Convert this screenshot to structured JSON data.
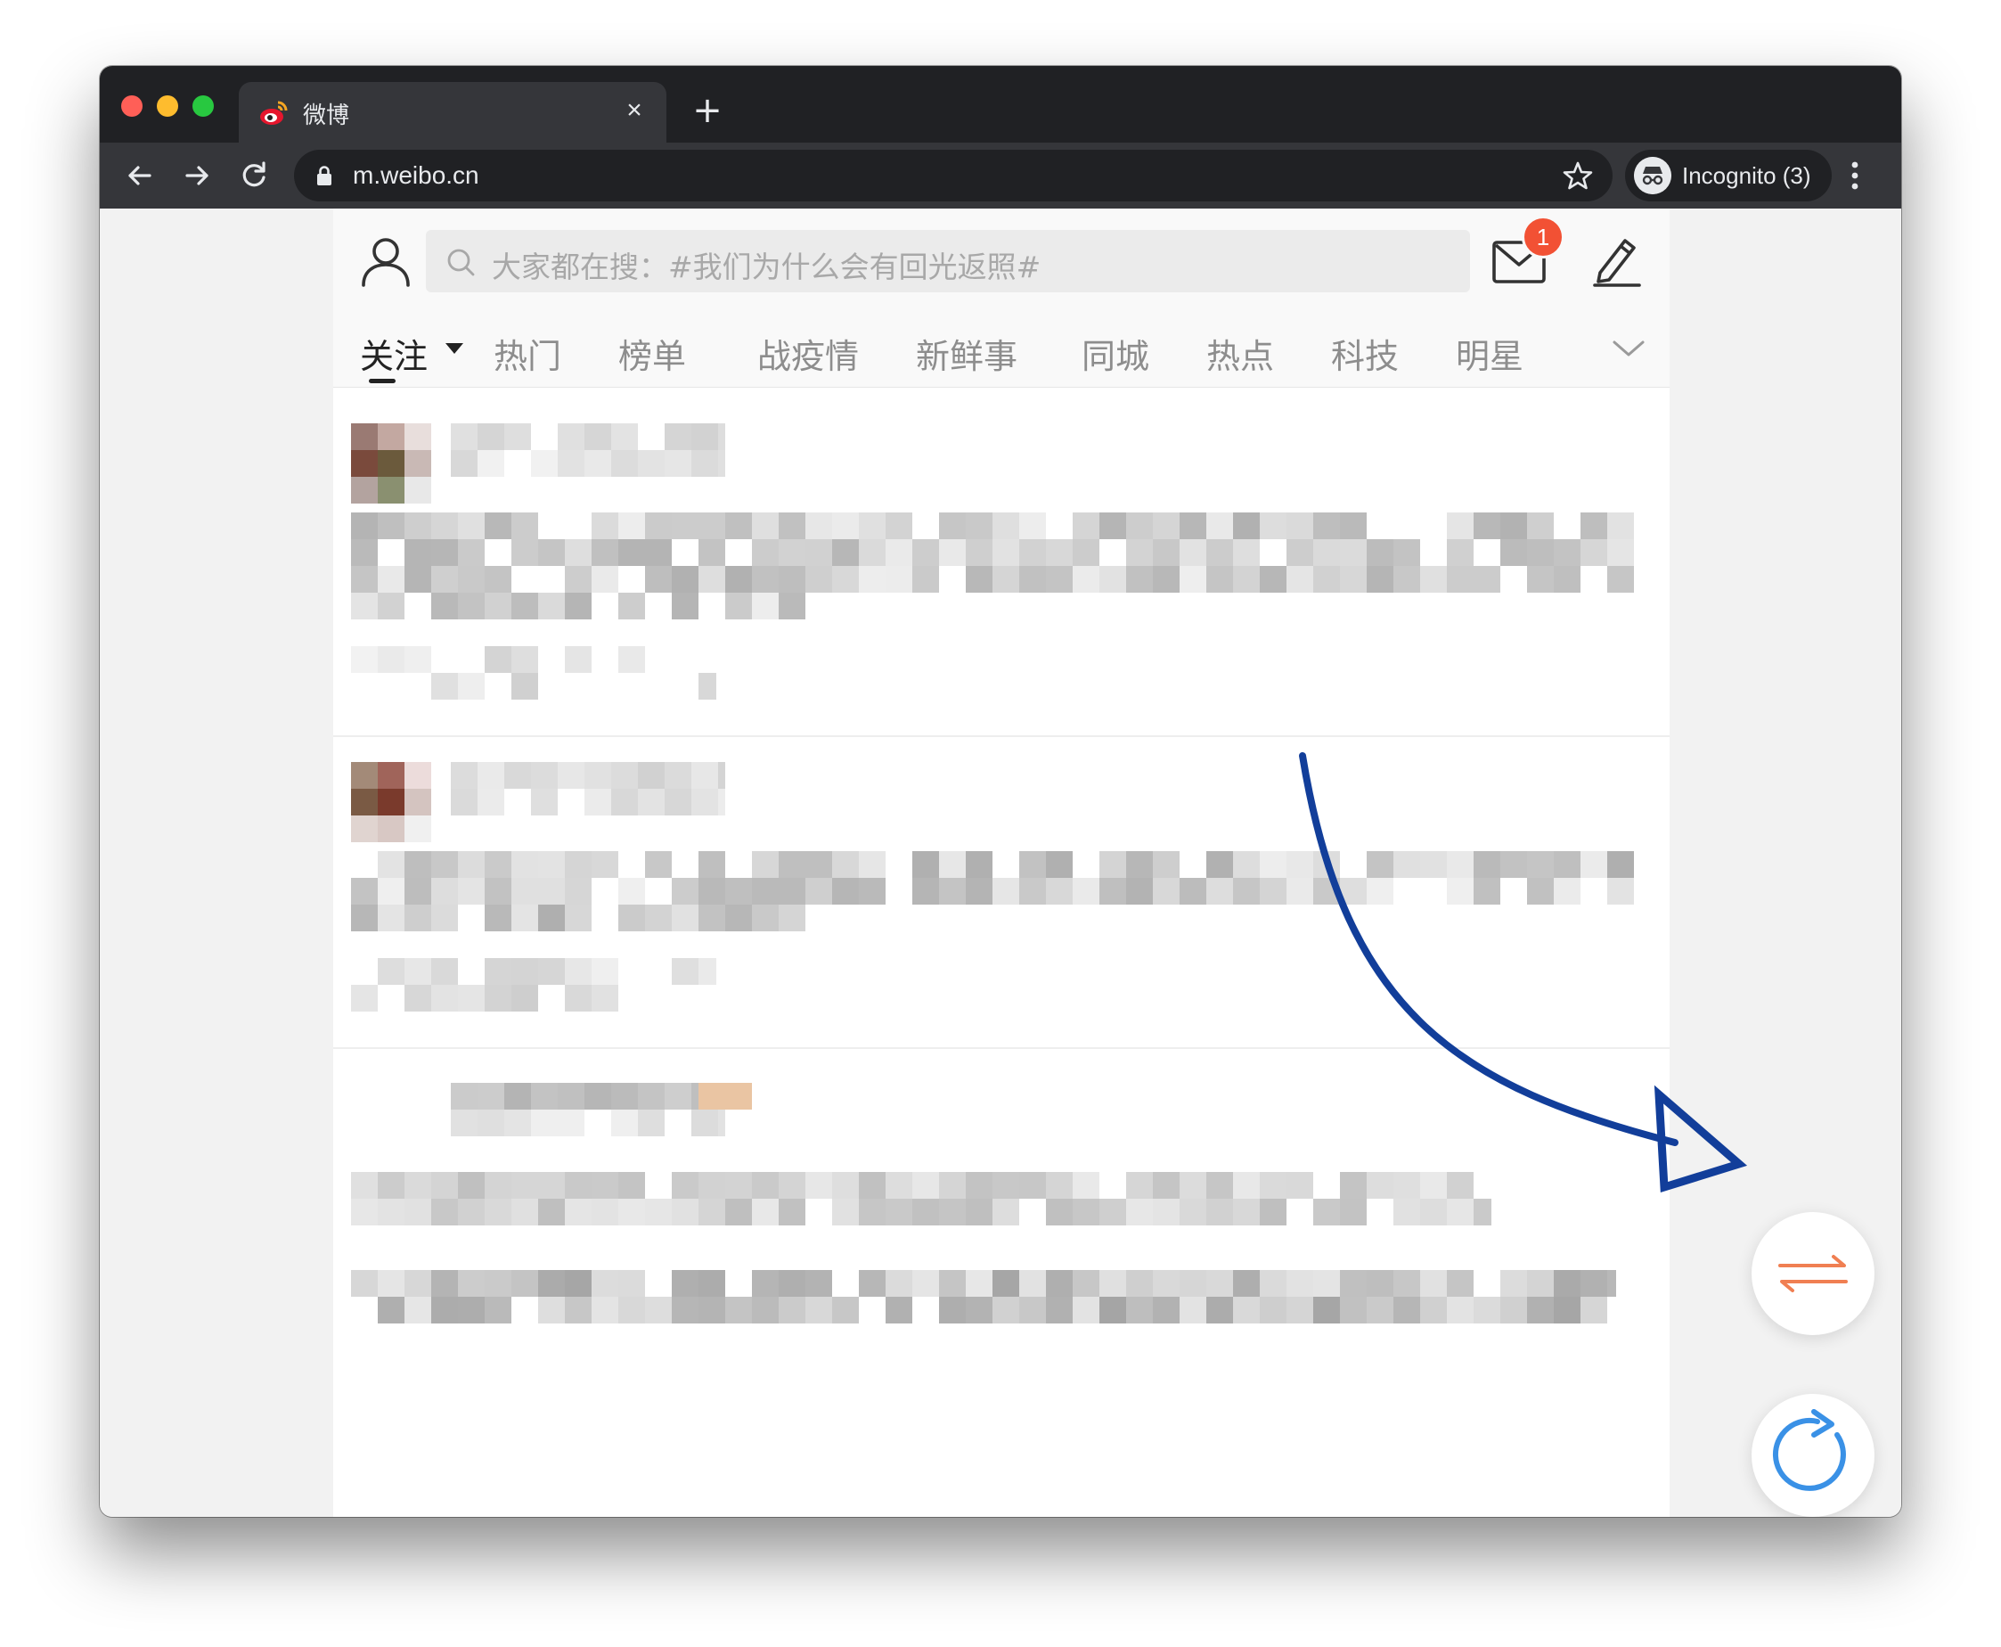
{
  "browser": {
    "tab": {
      "title": "微博",
      "close_label": "×"
    },
    "new_tab_label": "+",
    "address": {
      "url": "m.weibo.cn"
    },
    "profile": {
      "label": "Incognito (3)"
    }
  },
  "weibo": {
    "search": {
      "placeholder": "大家都在搜：#我们为什么会有回光返照#"
    },
    "mail_badge": "1",
    "channels": [
      "关注",
      "热门",
      "榜单",
      "战疫情",
      "新鲜事",
      "同城",
      "热点",
      "科技",
      "明星"
    ],
    "active_channel": "关注"
  },
  "colors": {
    "browser_frame": "#202124",
    "toolbar": "#35363a",
    "badge": "#f25134",
    "swap_icon": "#f07f52",
    "refresh_icon": "#3a91e6",
    "annotation_arrow": "#123e9a"
  },
  "icons": [
    "weibo-favicon",
    "back-arrow-icon",
    "forward-arrow-icon",
    "reload-icon",
    "lock-icon",
    "star-icon",
    "incognito-icon",
    "more-vert-icon",
    "user-icon",
    "search-icon",
    "mail-icon",
    "compose-icon",
    "chevron-down-icon",
    "swap-arrows-icon",
    "refresh-icon"
  ]
}
